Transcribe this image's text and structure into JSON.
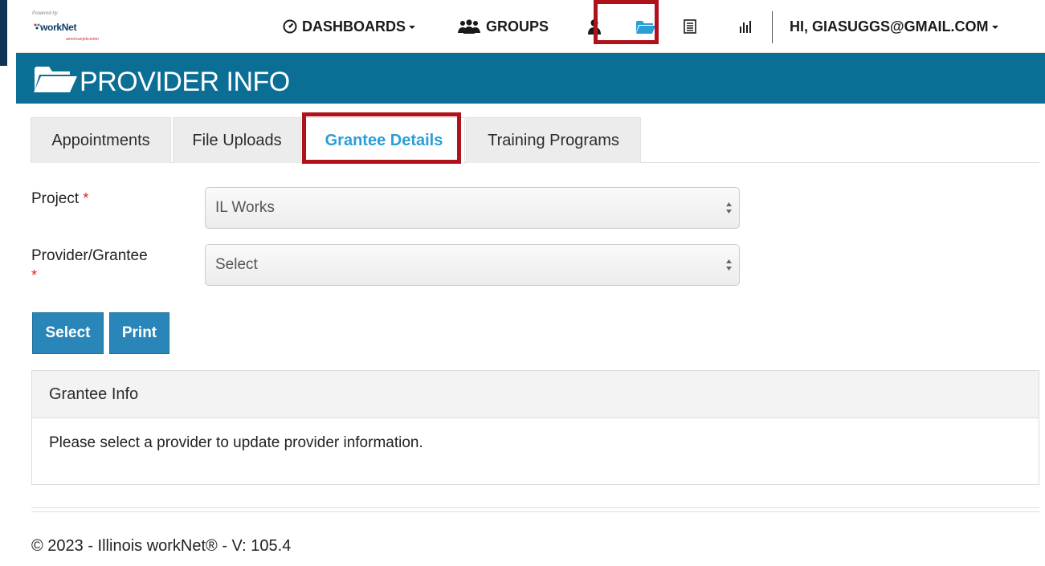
{
  "brand": {
    "powered_by": "Powered by",
    "name": "workNet",
    "sub": "americanjobcenter"
  },
  "nav": {
    "dashboards": "DASHBOARDS",
    "groups": "GROUPS",
    "user_greeting": "HI, GIASUGGS@GMAIL.COM"
  },
  "page": {
    "title": "PROVIDER INFO"
  },
  "tabs": [
    {
      "label": "Appointments"
    },
    {
      "label": "File Uploads"
    },
    {
      "label": "Grantee Details"
    },
    {
      "label": "Training Programs"
    }
  ],
  "form": {
    "project_label": "Project",
    "project_value": "IL Works",
    "provider_label": "Provider/Grantee",
    "provider_value": "Select",
    "required_mark": "*"
  },
  "buttons": {
    "select": "Select",
    "print": "Print"
  },
  "panel": {
    "heading": "Grantee Info",
    "message": "Please select a provider to update provider information."
  },
  "footer": {
    "text": "© 2023 - Illinois workNet® - V: 105.4"
  },
  "colors": {
    "banner": "#0b6e95",
    "accent": "#2a9fd6",
    "button": "#2a86b8",
    "highlight": "#b0121b",
    "required": "#d9261c"
  },
  "icons": [
    "speedometer-icon",
    "groups-icon",
    "user-icon",
    "folder-open-icon",
    "list-icon",
    "bar-chart-icon"
  ]
}
